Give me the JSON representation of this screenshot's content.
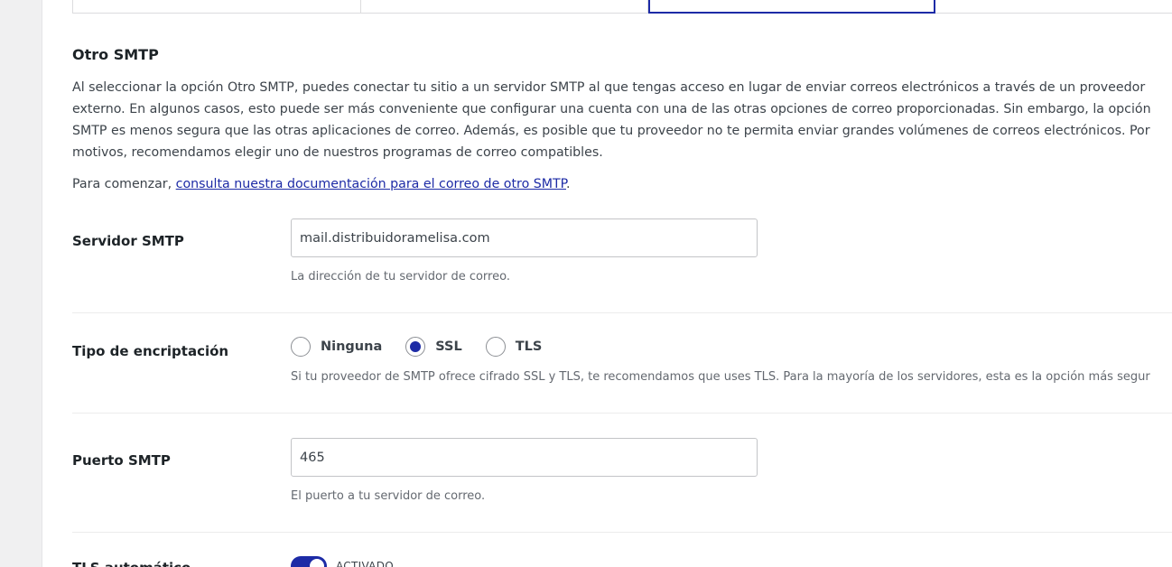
{
  "section": {
    "title": "Otro SMTP",
    "description_lines": [
      "Al seleccionar la opción Otro SMTP, puedes conectar tu sitio a un servidor SMTP al que tengas acceso en lugar de enviar correos electrónicos a través de un proveedor",
      "externo. En algunos casos, esto puede ser más conveniente que configurar una cuenta con una de las otras opciones de correo proporcionadas. Sin embargo, la opción",
      "SMTP es menos segura que las otras aplicaciones de correo. Además, es posible que tu proveedor no te permita enviar grandes volúmenes de correos electrónicos. Por",
      "motivos, recomendamos elegir uno de nuestros programas de correo compatibles."
    ],
    "intro_prefix": "Para comenzar, ",
    "intro_link": "consulta nuestra documentación para el correo de otro SMTP",
    "intro_suffix": "."
  },
  "smtp_host": {
    "label": "Servidor SMTP",
    "value": "mail.distribuidoramelisa.com",
    "help": "La dirección de tu servidor de correo."
  },
  "encryption": {
    "label": "Tipo de encriptación",
    "options": [
      "Ninguna",
      "SSL",
      "TLS"
    ],
    "selected": "SSL",
    "help": "Si tu proveedor de SMTP ofrece cifrado SSL y TLS, te recomendamos que uses TLS. Para la mayoría de los servidores, esta es la opción más segur"
  },
  "smtp_port": {
    "label": "Puerto SMTP",
    "value": "465",
    "help": "El puerto a tu servidor de correo."
  },
  "auto_tls": {
    "label": "TLS automático",
    "state": "ACTIVADO",
    "enabled": true
  },
  "colors": {
    "accent": "#1d2ba6",
    "text": "#3c434a",
    "muted": "#646970"
  }
}
